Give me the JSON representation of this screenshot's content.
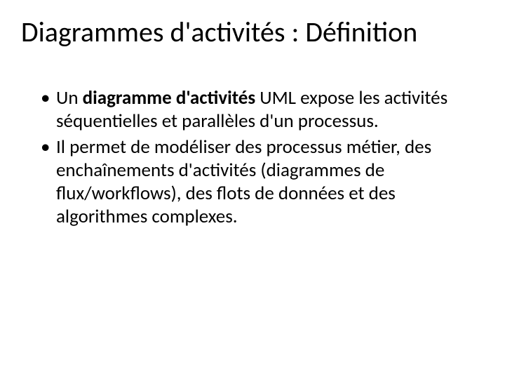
{
  "title": "Diagrammes d'activités :  Définition",
  "bullets": [
    {
      "pre": "Un ",
      "bold": "diagramme d'activités",
      "post": " UML expose les activités séquentielles et parallèles d'un processus."
    },
    {
      "pre": "",
      "bold": "",
      "post": "Il permet de modéliser des processus métier, des enchaînements d'activités (diagrammes de flux/workflows), des flots de données et des algorithmes complexes."
    }
  ]
}
